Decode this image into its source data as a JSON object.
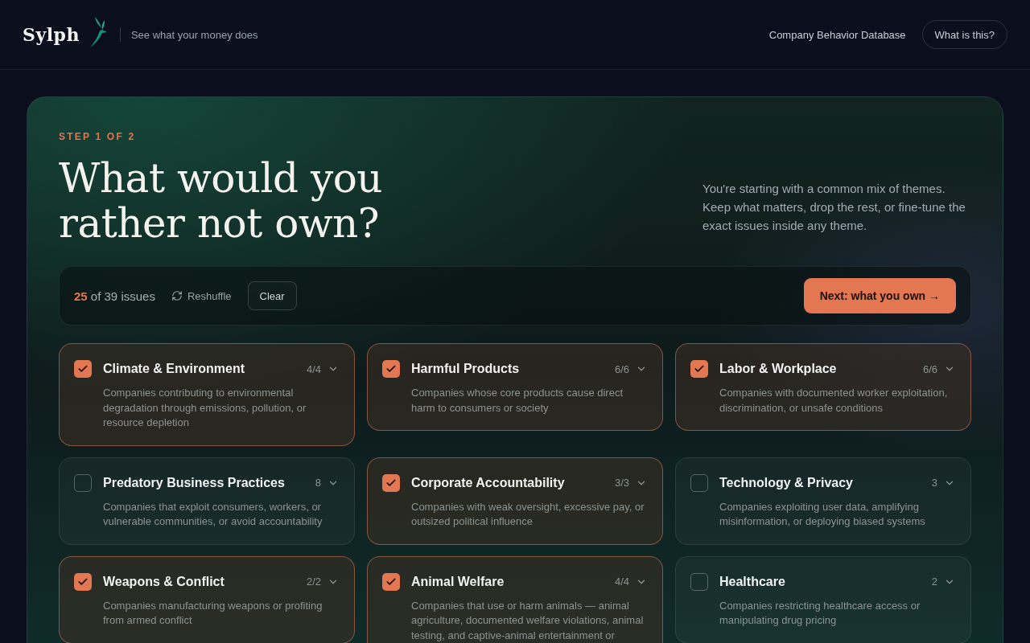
{
  "header": {
    "logo": "Sylph",
    "tagline": "See what your money does",
    "nav_link": "Company Behavior Database",
    "help_button": "What is this?"
  },
  "intro": {
    "step": "STEP 1 OF 2",
    "heading": "What would you rather not own?",
    "description": "You're starting with a common mix of themes. Keep what matters, drop the rest, or fine-tune the exact issues inside any theme."
  },
  "toolbar": {
    "summary": "**25** of 39 issues",
    "reshuffle": "Reshuffle",
    "clear": "Clear",
    "next": "Next: what you own →"
  },
  "themes": [
    {
      "title": "Climate & Environment",
      "count": "4/4",
      "description": "Companies contributing to environmental degradation through emissions, pollution, or resource depletion",
      "checked": true
    },
    {
      "title": "Harmful Products",
      "count": "6/6",
      "description": "Companies whose core products cause direct harm to consumers or society",
      "checked": true
    },
    {
      "title": "Labor & Workplace",
      "count": "6/6",
      "description": "Companies with documented worker exploitation, discrimination, or unsafe conditions",
      "checked": true
    },
    {
      "title": "Predatory Business Practices",
      "count": "8",
      "description": "Companies that exploit consumers, workers, or vulnerable communities, or avoid accountability",
      "checked": false
    },
    {
      "title": "Corporate Accountability",
      "count": "3/3",
      "description": "Companies with weak oversight, excessive pay, or outsized political influence",
      "checked": true
    },
    {
      "title": "Technology & Privacy",
      "count": "3",
      "description": "Companies exploiting user data, amplifying misinformation, or deploying biased systems",
      "checked": false
    },
    {
      "title": "Weapons & Conflict",
      "count": "2/2",
      "description": "Companies manufacturing weapons or profiting from armed conflict",
      "checked": true
    },
    {
      "title": "Animal Welfare",
      "count": "4/4",
      "description": "Companies that use or harm animals — animal agriculture, documented welfare violations, animal testing, and captive-animal entertainment or",
      "checked": true
    },
    {
      "title": "Healthcare",
      "count": "2",
      "description": "Companies restricting healthcare access or manipulating drug pricing",
      "checked": false
    }
  ]
}
